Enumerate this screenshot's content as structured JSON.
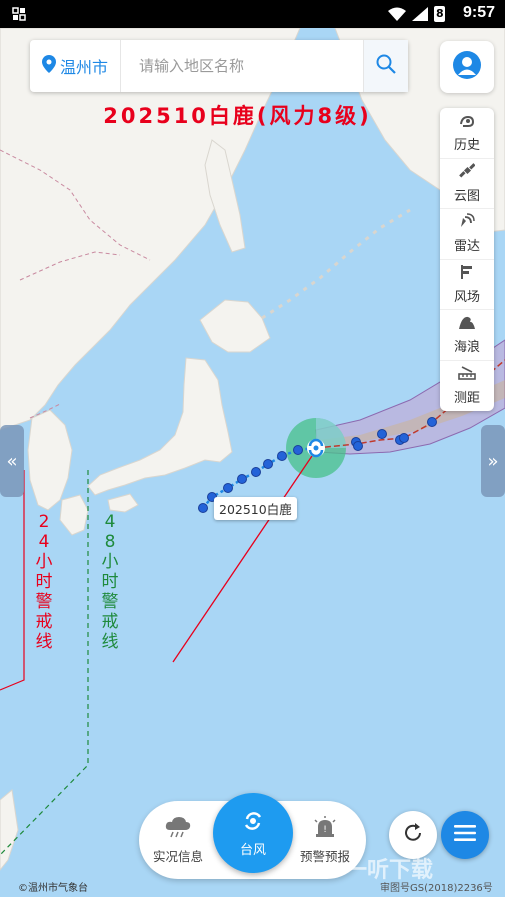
{
  "status": {
    "time": "9:57",
    "battery": "8"
  },
  "search": {
    "city": "温州市",
    "placeholder": "请输入地区名称"
  },
  "typhoon": {
    "title": "202510白鹿(风力8级)",
    "label": "202510白鹿"
  },
  "layers": [
    {
      "label": "历史",
      "icon": "history-icon"
    },
    {
      "label": "云图",
      "icon": "satellite-icon"
    },
    {
      "label": "雷达",
      "icon": "radar-icon"
    },
    {
      "label": "风场",
      "icon": "wind-icon"
    },
    {
      "label": "海浪",
      "icon": "wave-icon"
    },
    {
      "label": "测距",
      "icon": "ruler-icon"
    }
  ],
  "warning_lines": {
    "line24": "24小时警戒线",
    "line48": "48小时警戒线"
  },
  "nav": {
    "live": "实况信息",
    "typhoon": "台风",
    "warning": "预警预报"
  },
  "footer": {
    "copyright": "©温州市气象台",
    "approval": "审图号GS(2018)2236号",
    "watermark": "一听下载"
  },
  "colors": {
    "accent": "#1e88e5",
    "title": "#e8001c",
    "warning24": "#e8001c",
    "warning48": "#1e8a3c",
    "sea": "#a9d6f5",
    "land": "#f4f3ef"
  }
}
